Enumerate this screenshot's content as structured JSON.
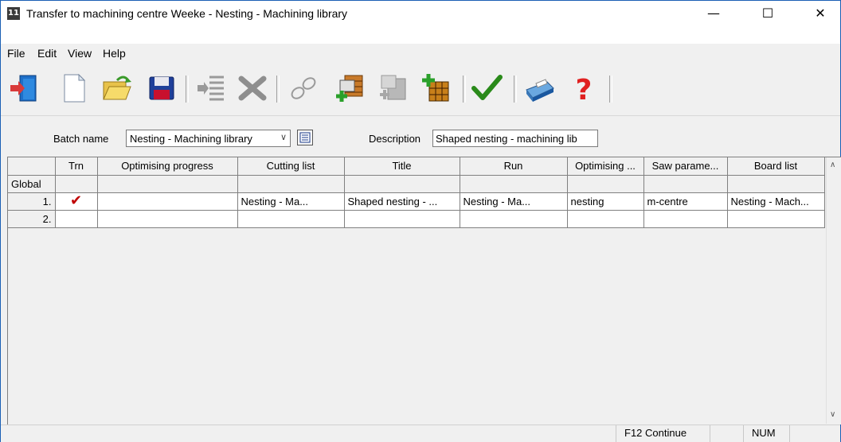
{
  "window": {
    "title": "Transfer to machining centre Weeke - Nesting - Machining library",
    "app_icon_text": "11",
    "controls": {
      "minimize": "—",
      "maximize": "☐",
      "close": "✕"
    }
  },
  "menu": {
    "file": "File",
    "edit": "Edit",
    "view": "View",
    "help": "Help"
  },
  "toolbar": {
    "icons": [
      "exit-icon",
      "new-icon",
      "open-icon",
      "save-icon",
      "indent-icon",
      "delete-icon",
      "link-icon",
      "add-material-icon",
      "copy-parts-icon",
      "add-board-icon",
      "check-icon",
      "print-icon",
      "help-icon"
    ]
  },
  "batch": {
    "batch_name_label": "Batch name",
    "batch_name_value": "Nesting - Machining library",
    "description_label": "Description",
    "description_value": "Shaped nesting - machining lib"
  },
  "grid": {
    "headers": [
      "Trn",
      "Optimising progress",
      "Cutting list",
      "Title",
      "Run",
      "Optimising ...",
      "Saw parame...",
      "Board list"
    ],
    "global_label": "Global",
    "rows": [
      {
        "num": "1.",
        "trn": "✔",
        "progress": "",
        "cutting_list": "Nesting - Ma...",
        "title": "Shaped nesting - ...",
        "run": "Nesting - Ma...",
        "optimising": "nesting",
        "saw": "m-centre",
        "board": "Nesting - Mach..."
      },
      {
        "num": "2.",
        "trn": "",
        "progress": "",
        "cutting_list": "",
        "title": "",
        "run": "",
        "optimising": "",
        "saw": "",
        "board": ""
      }
    ]
  },
  "status": {
    "hint": "F12 Continue",
    "num": "NUM"
  },
  "colors": {
    "window_border": "#1a5fb4",
    "check_mark": "#c00000"
  }
}
